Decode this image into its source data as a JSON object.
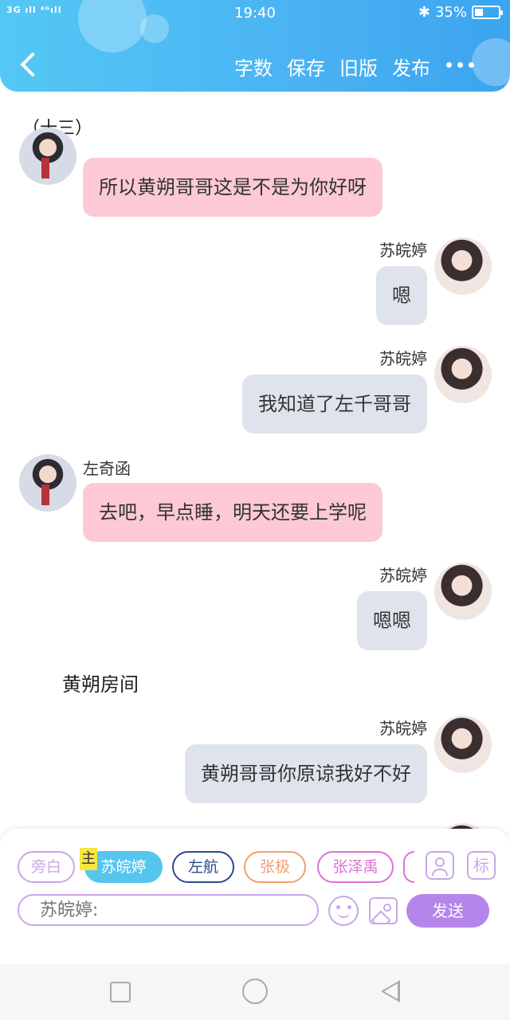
{
  "status_bar": {
    "signal": "3G ıll ⁴ᴳıll",
    "time": "19:40",
    "bluetooth": "✱",
    "battery_percent": "35%",
    "battery_level": 0.35
  },
  "header": {
    "menu": [
      "字数",
      "保存",
      "旧版",
      "发布"
    ]
  },
  "chat": {
    "chapter": "（十三）",
    "messages": [
      {
        "speaker": "",
        "side": "left",
        "text": "所以黄朔哥哥这是不是为你好呀"
      },
      {
        "speaker": "苏皖婷",
        "side": "right",
        "text": "嗯"
      },
      {
        "speaker": "苏皖婷",
        "side": "right",
        "text": "我知道了左千哥哥"
      },
      {
        "speaker": "左奇函",
        "side": "left",
        "text": "去吧，早点睡，明天还要上学呢"
      },
      {
        "speaker": "苏皖婷",
        "side": "right",
        "text": "嗯嗯"
      },
      {
        "speaker": "苏皖婷",
        "side": "right",
        "text": "黄朔哥哥你原谅我好不好"
      }
    ],
    "scene_label": "黄朔房间"
  },
  "composer": {
    "roles": [
      {
        "label": "旁白",
        "color": "#c8a8e8"
      },
      {
        "label": "苏皖婷",
        "color": "#56c6ef",
        "selected": true
      },
      {
        "label": "左航",
        "color": "#2a4a8a"
      },
      {
        "label": "张极",
        "color": "#f0a070"
      },
      {
        "label": "张泽禹",
        "color": "#e070d8"
      }
    ],
    "main_badge": "主",
    "tag_icon_label": "标",
    "input_placeholder": "苏皖婷:",
    "send_label": "发送",
    "accent_color": "#b585ea"
  }
}
